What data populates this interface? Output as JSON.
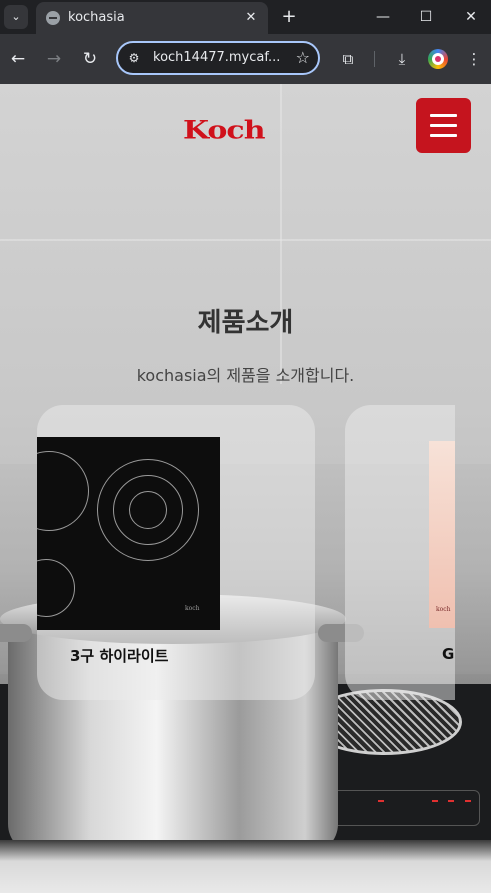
{
  "browser": {
    "tab_title": "kochasia",
    "url": "koch14477.mycaf...",
    "icons": {
      "tab_search": "chevron-down-icon",
      "close_tab": "close-icon",
      "new_tab": "plus-icon",
      "back": "arrow-left-icon",
      "forward": "arrow-right-icon",
      "reload": "reload-icon",
      "site_info": "tune-icon",
      "bookmark": "star-icon",
      "extensions": "puzzle-icon",
      "download": "download-icon",
      "menu": "kebab-icon",
      "minimize": "minimize-icon",
      "maximize": "maximize-icon",
      "close_window": "close-window-icon"
    }
  },
  "page": {
    "logo_text": "Koch",
    "brand_color": "#c5141e",
    "section_title": "제품소개",
    "section_subtitle": "kochasia의 제품을 소개합니다.",
    "products": [
      {
        "name": "3구 하이라이트",
        "image_brand": "koch"
      },
      {
        "name": "G",
        "image_brand": "koch"
      }
    ]
  }
}
